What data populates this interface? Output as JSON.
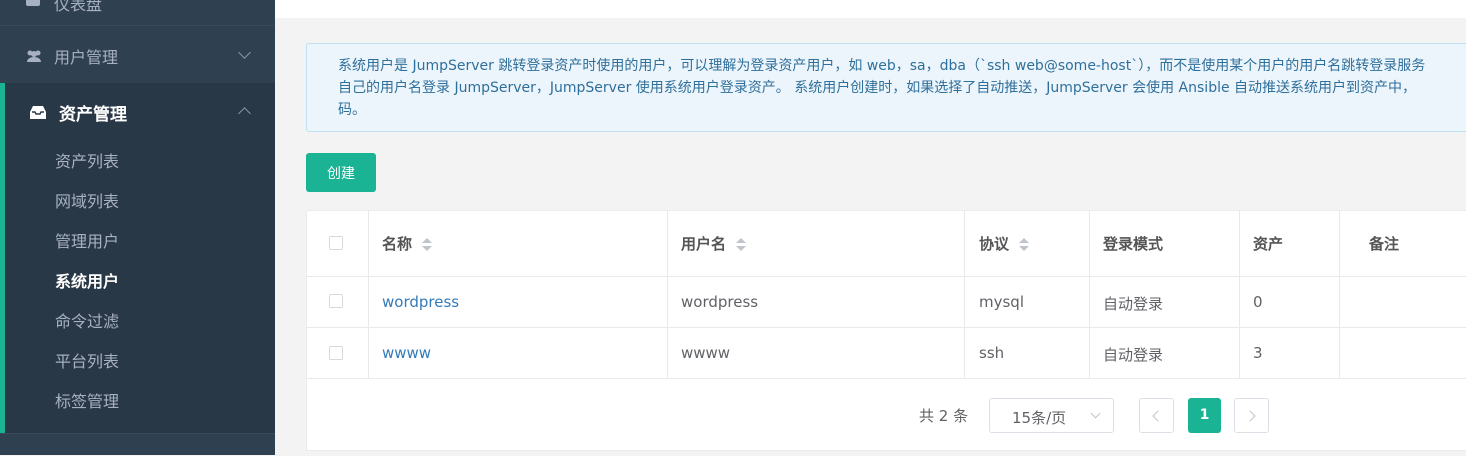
{
  "sidebar": {
    "top_item": {
      "label": "仪表盘",
      "icon": "dashboard-icon"
    },
    "user_mgmt": {
      "label": "用户管理",
      "icon": "users-icon"
    },
    "asset_mgmt": {
      "label": "资产管理",
      "icon": "inbox-icon",
      "items": [
        {
          "label": "资产列表"
        },
        {
          "label": "网域列表"
        },
        {
          "label": "管理用户"
        },
        {
          "label": "系统用户",
          "active": true
        },
        {
          "label": "命令过滤"
        },
        {
          "label": "平台列表"
        },
        {
          "label": "标签管理"
        }
      ]
    },
    "accent_color": "#1ab394"
  },
  "alert": {
    "line1": "系统用户是 JumpServer 跳转登录资产时使用的用户，可以理解为登录资产用户，如 web，sa，dba（`ssh web@some-host`），而不是使用某个用户的用户名跳转登录服务",
    "line2": "自己的用户名登录 JumpServer，JumpServer 使用系统用户登录资产。 系统用户创建时，如果选择了自动推送，JumpServer 会使用 Ansible 自动推送系统用户到资产中，",
    "line3": "码。"
  },
  "create_button": "创建",
  "table": {
    "headers": {
      "name": "名称",
      "username": "用户名",
      "protocol": "协议",
      "login_mode": "登录模式",
      "assets": "资产",
      "comment": "备注"
    },
    "rows": [
      {
        "name": "wordpress",
        "username": "wordpress",
        "protocol": "mysql",
        "login_mode": "自动登录",
        "assets": "0"
      },
      {
        "name": "wwww",
        "username": "wwww",
        "protocol": "ssh",
        "login_mode": "自动登录",
        "assets": "3"
      }
    ]
  },
  "pagination": {
    "total": "共 2 条",
    "page_size": "15条/页",
    "current_page": "1"
  }
}
